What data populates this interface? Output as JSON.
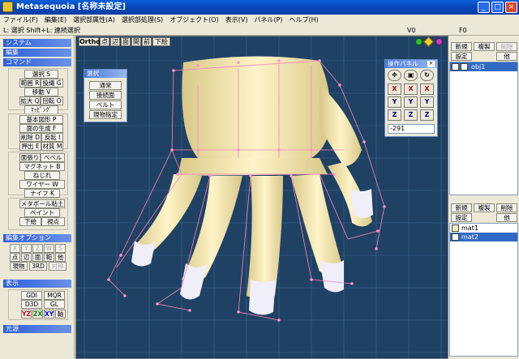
{
  "window": {
    "title": "Metasequoia [名称未設定]",
    "btn_min": "_",
    "btn_max": "□",
    "btn_close": "×"
  },
  "menu": [
    "ファイル(F)",
    "編集(E)",
    "選択部属性(A)",
    "選択部処理(S)",
    "オブジェクト(O)",
    "表示(V)",
    "パネル(P)",
    "ヘルプ(H)"
  ],
  "status": {
    "hint": "L: 選択  Shift+L: 連続選択",
    "v": "V0",
    "f": "F0"
  },
  "left": {
    "sec_system": "システム",
    "sec_edit": "編集",
    "sec_command": "コマンド",
    "cmd1": [
      "選択 S",
      "範囲 R",
      "投縄 G",
      "移動 V",
      "拡大 Q",
      "回転 O",
      "ﾏｯﾋﾟﾝｸﾞ"
    ],
    "cmd2": [
      "基本図形 P",
      "面の生成 F",
      "削除 D",
      "反転 I",
      "押出 E",
      "材質 M"
    ],
    "cmd3": [
      "面張り",
      "ベベル",
      "マグネット B",
      "ねじれ",
      "ワイヤー W",
      "ナイフ K"
    ],
    "cmd4": [
      "メタボール粘土",
      "ペイント",
      "下絵",
      "視点"
    ],
    "sec_editopt": "編集オプション",
    "opt": [
      "X",
      "Y",
      "Z",
      "W",
      "S",
      "点",
      "辺",
      "面",
      "範",
      "他",
      "現物",
      "3RD",
      "対称"
    ],
    "sec_view": "表示",
    "view": [
      "GDI",
      "MQR",
      "D3D",
      "GL",
      "YZ",
      "ZX",
      "XY",
      "軸"
    ],
    "sec_light": "光源"
  },
  "viewport": {
    "buttons": [
      "Ortho",
      "点",
      "辺",
      "面",
      "間",
      "前",
      "下絵"
    ]
  },
  "selwin": {
    "title": "選択",
    "items": [
      "通常",
      "接続面",
      "ベルト",
      "現物指定"
    ]
  },
  "opwin": {
    "title": "操作パネル",
    "axes": [
      "X",
      "X",
      "X",
      "Y",
      "Y",
      "Y",
      "Z",
      "Z",
      "Z"
    ],
    "value": "-291"
  },
  "right": {
    "obj_btns": [
      "新規",
      "複製",
      "削除",
      "設定",
      "他"
    ],
    "objects": [
      {
        "name": "obj1"
      }
    ],
    "mat_btns": [
      "新規",
      "複製",
      "削除",
      "設定",
      "他"
    ],
    "materials": [
      {
        "name": "mat1",
        "color": "#f6f0c0"
      },
      {
        "name": "mat2",
        "color": "#ffffff"
      }
    ]
  },
  "colors": {
    "accent": "#316ac5",
    "viewport_bg": "#1f4163",
    "mesh": "#ff80c0"
  }
}
